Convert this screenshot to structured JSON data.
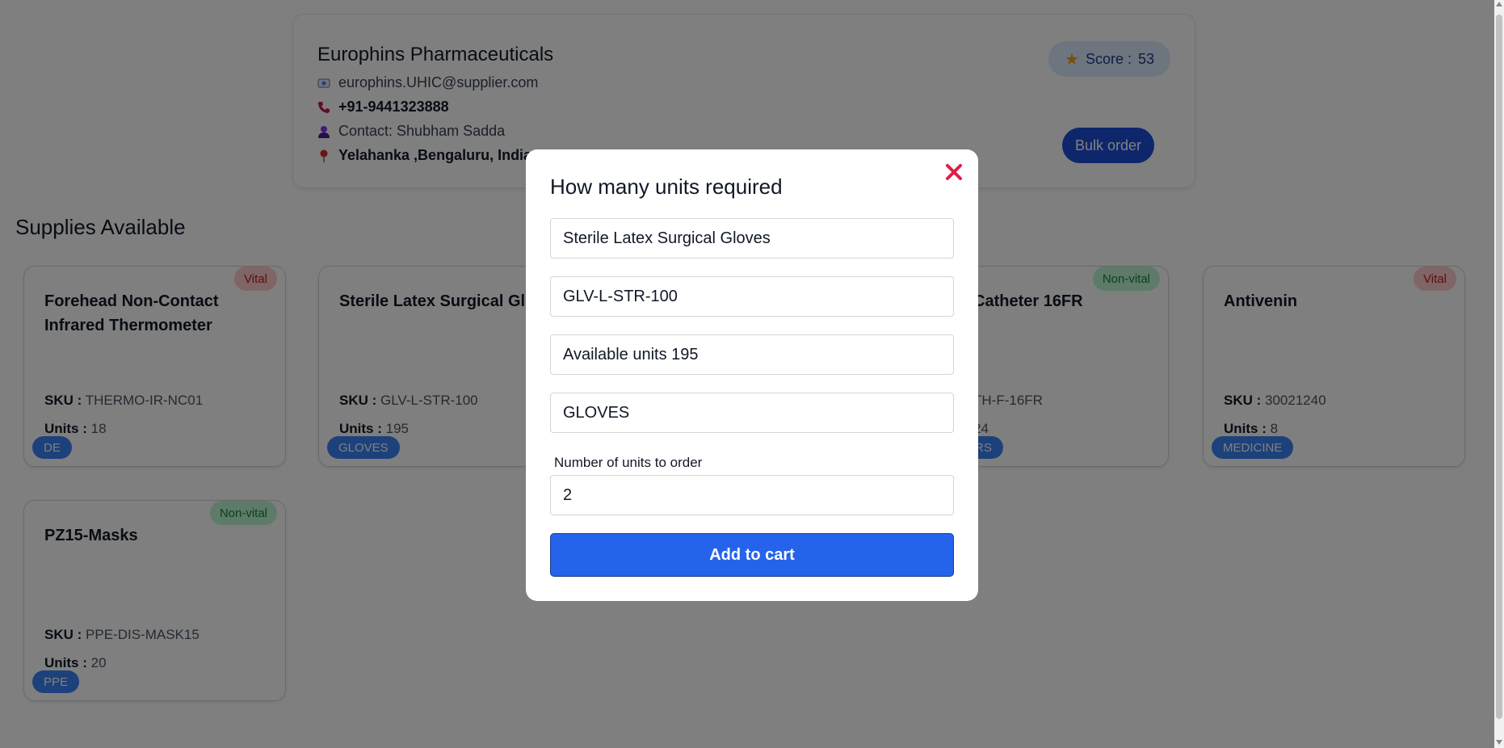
{
  "supplier": {
    "name": "Europhins Pharmaceuticals",
    "email": "europhins.UHIC@supplier.com",
    "phone": "+91-9441323888",
    "contact": "Contact: Shubham Sadda",
    "address": "Yelahanka ,Bengaluru, India",
    "score_label": "Score :",
    "score_value": "53",
    "bulk_order_label": "Bulk order"
  },
  "section_title": "Supplies Available",
  "products": [
    {
      "tag": "Vital",
      "title": "Forehead Non-Contact Infrared Thermometer",
      "sku_label": "SKU :",
      "sku": "THERMO-IR-NC01",
      "units_label": "Units :",
      "units": "18",
      "category": "DE"
    },
    {
      "tag": "",
      "title": "Sterile Latex Surgical Glo",
      "sku_label": "SKU :",
      "sku": "GLV-L-STR-100",
      "units_label": "Units :",
      "units": "195",
      "category": "GLOVES"
    },
    {
      "tag": "Non-vital",
      "title": "Catheter 16FR",
      "sku_label": "",
      "sku": "TH-F-16FR",
      "units_label": "",
      "units": "24",
      "category": "RS"
    },
    {
      "tag": "Vital",
      "title": "Antivenin",
      "sku_label": "SKU :",
      "sku": "30021240",
      "units_label": "Units :",
      "units": "8",
      "category": "MEDICINE"
    },
    {
      "tag": "Non-vital",
      "title": "PZ15-Masks",
      "sku_label": "SKU :",
      "sku": "PPE-DIS-MASK15",
      "units_label": "Units :",
      "units": "20",
      "category": "PPE"
    }
  ],
  "modal": {
    "title": "How many units required",
    "product_name": "Sterile Latex Surgical Gloves",
    "sku": "GLV-L-STR-100",
    "available": "Available units 195",
    "category": "GLOVES",
    "qty_label": "Number of units to order",
    "qty_value": "2",
    "add_button": "Add to cart"
  },
  "colors": {
    "accent": "#2563eb",
    "vital_bg": "#fecaca",
    "nonvital_bg": "#bbf7d0",
    "close": "#e11d48"
  }
}
